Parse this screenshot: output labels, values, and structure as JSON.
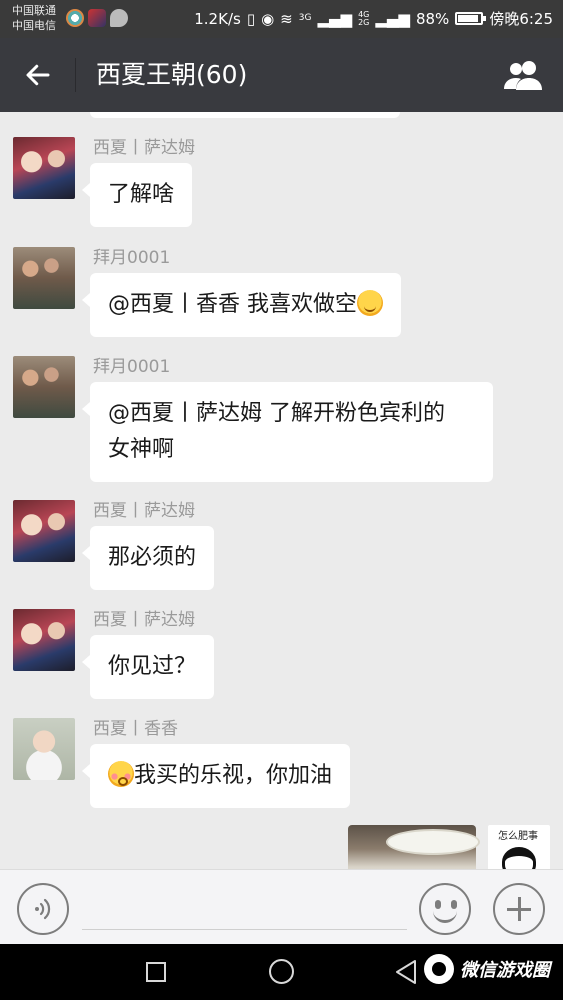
{
  "status_bar": {
    "carrier_1": "中国联通",
    "carrier_2": "中国电信",
    "network_speed": "1.2K/s",
    "signal_3g": "3G",
    "signal_4g": "4G",
    "signal_2g": "2G",
    "battery_percent": "88%",
    "battery_level": 0.88,
    "time": "傍晚6:25"
  },
  "header": {
    "title": "西夏王朝(60)"
  },
  "messages": [
    {
      "sender": "西夏丨萨达姆",
      "text": "了解啥",
      "avatar": "saddam-avatar"
    },
    {
      "sender": "拜月0001",
      "text": "@西夏丨香香 我喜欢做空",
      "emoji": "grinning-face-emoji",
      "avatar": "baiyue-avatar"
    },
    {
      "sender": "拜月0001",
      "text_line1": "@西夏丨萨达姆 了解开粉色宾利的",
      "text_line2": "女神啊",
      "avatar": "baiyue-avatar"
    },
    {
      "sender": "西夏丨萨达姆",
      "text": "那必须的",
      "avatar": "saddam-avatar"
    },
    {
      "sender": "西夏丨萨达姆",
      "text": "你见过？",
      "avatar": "saddam-avatar"
    },
    {
      "sender": "西夏丨香香",
      "text": "我买的乐视，你加油",
      "emoji": "blushing-face-emoji",
      "avatar": "xiangxiang-avatar"
    }
  ],
  "self_avatar_caption": "怎么肥事",
  "watermark": {
    "text": "微信游戏圈"
  },
  "icons": {
    "back": "arrow-left-icon",
    "members": "group-members-icon",
    "voice": "voice-input-icon",
    "emoji": "emoji-icon",
    "plus": "plus-icon"
  }
}
